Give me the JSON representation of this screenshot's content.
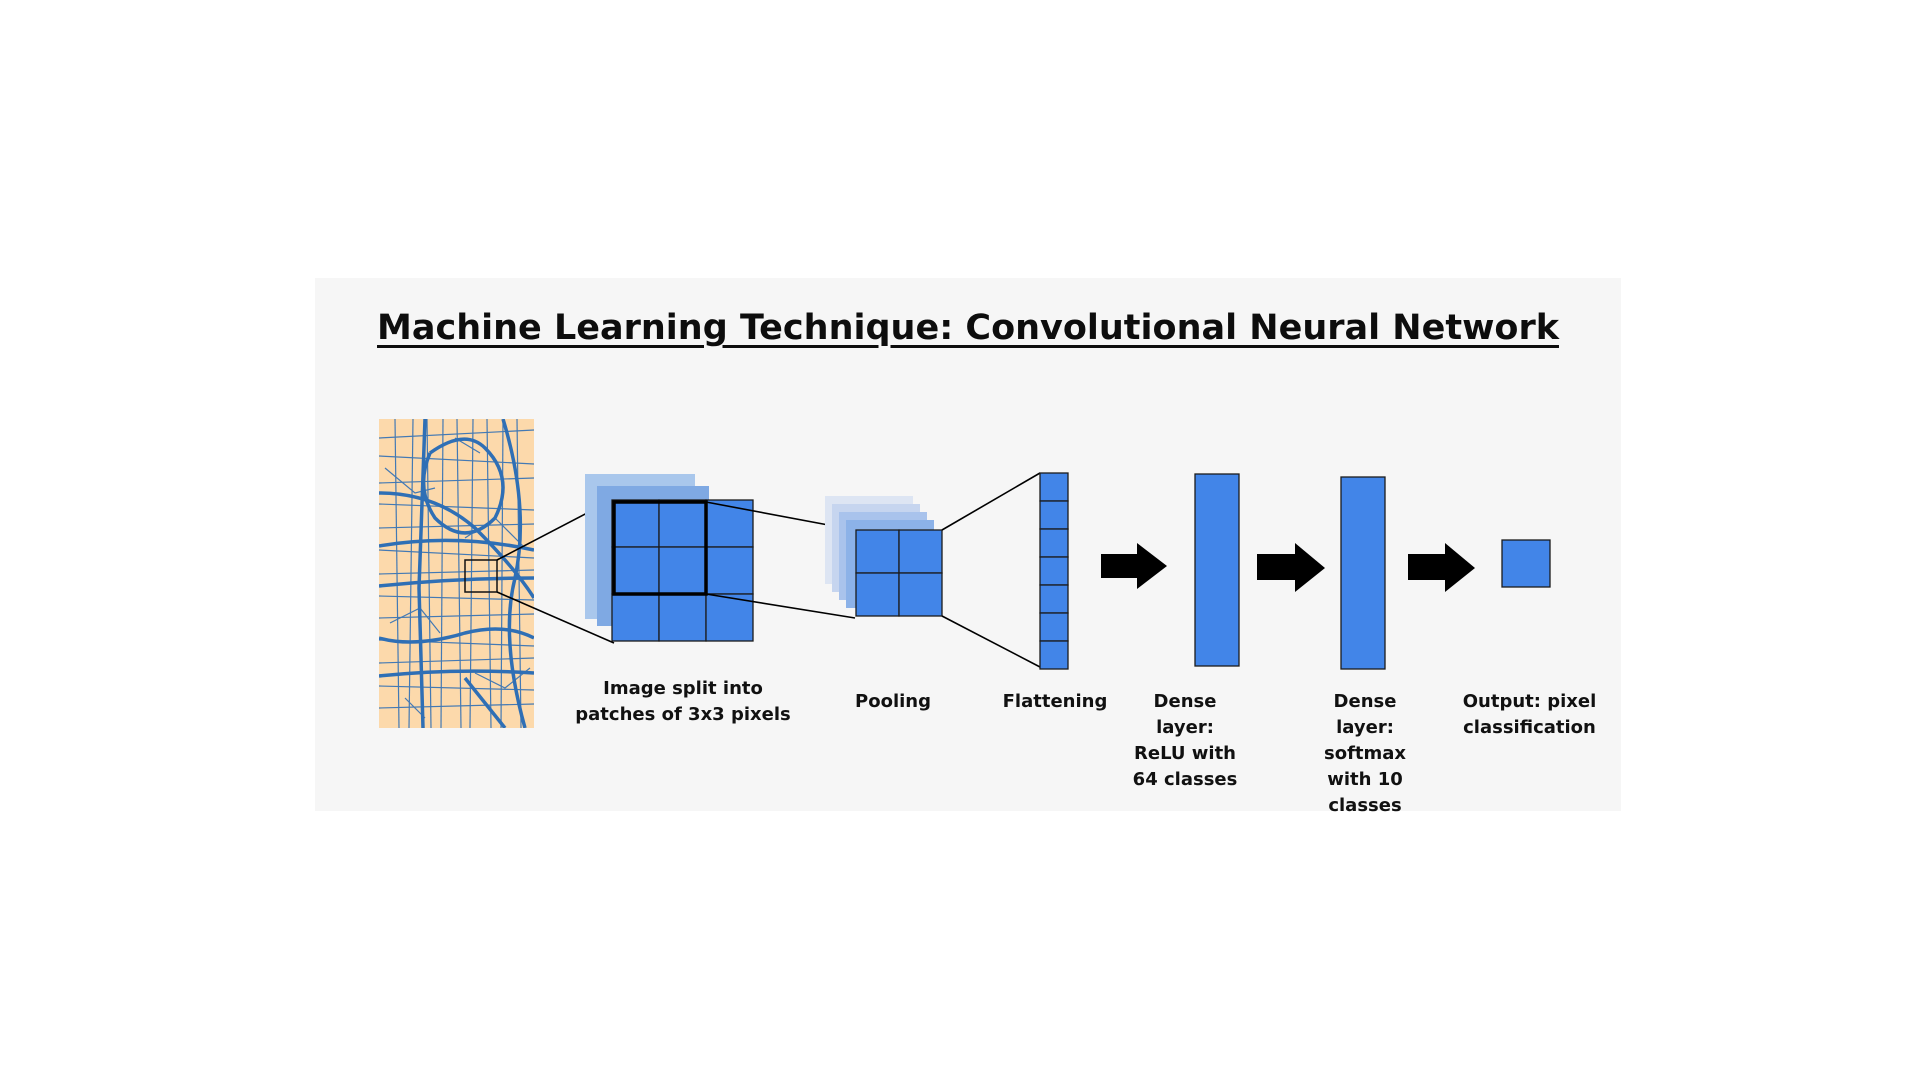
{
  "title": "Machine Learning Technique: Convolutional Neural Network",
  "colors": {
    "panel_background": "#f6f6f6",
    "neuron_blue": "#4285e8",
    "map_background": "#fcd9ab",
    "map_roads": "#2f6fb5",
    "arrow": "#000000"
  },
  "stages": [
    {
      "name": "input-map",
      "caption": ""
    },
    {
      "name": "patches",
      "caption": "Image split into patches of 3x3 pixels"
    },
    {
      "name": "pooling",
      "caption": "Pooling"
    },
    {
      "name": "flattening",
      "caption": "Flattening"
    },
    {
      "name": "dense-relu",
      "caption": "Dense layer: ReLU with 64 classes"
    },
    {
      "name": "dense-softmax",
      "caption": "Dense layer: softmax with 10 classes"
    },
    {
      "name": "output",
      "caption": "Output: pixel classification"
    }
  ],
  "icons": [
    "right-arrow-icon",
    "right-arrow-icon",
    "right-arrow-icon"
  ]
}
